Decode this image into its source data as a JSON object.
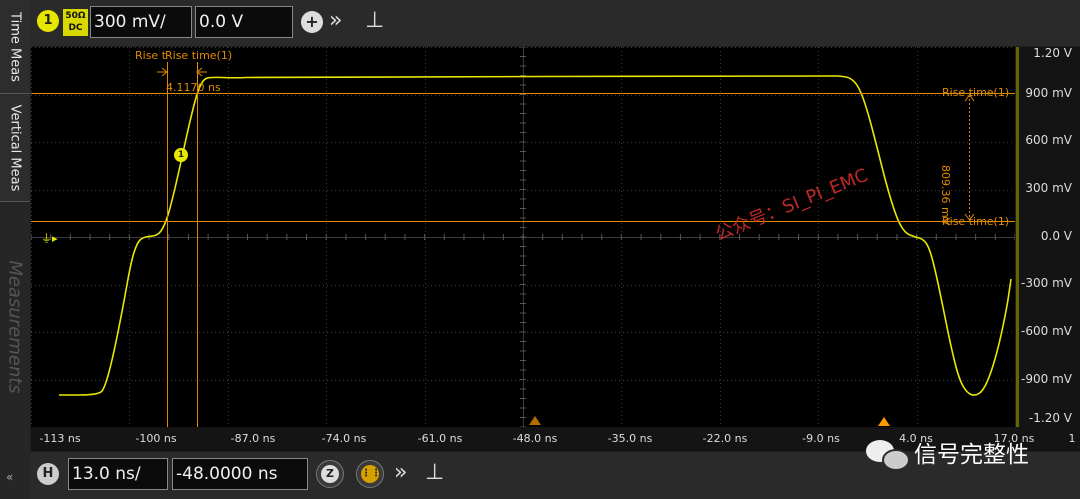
{
  "channel": {
    "number": "1",
    "impedance": "50Ω",
    "coupling": "DC",
    "scale": "300 mV/",
    "offset": "0.0 V"
  },
  "left_tabs": [
    "Time Meas",
    "Vertical Meas",
    "Measurements"
  ],
  "y_axis_labels": [
    "1.20 V",
    "900 mV",
    "600 mV",
    "300 mV",
    "0.0 V",
    "-300 mV",
    "-600 mV",
    "-900 mV",
    "-1.20 V"
  ],
  "x_axis_labels": [
    "-113 ns",
    "-100 ns",
    "-87.0 ns",
    "-74.0 ns",
    "-61.0 ns",
    "-48.0 ns",
    "-35.0 ns",
    "-22.0 ns",
    "-9.0 ns",
    "4.0 ns",
    "17.0 ns"
  ],
  "x_axis_edge": "1",
  "cursor_labels": {
    "rise_left": "Rise t",
    "rise_main": "Rise time(1)",
    "delta_value": "4.1170 ns",
    "upper_marker": "Rise time(1)",
    "lower_marker": "Rise time(1)",
    "vertical_delta": "809.36 mV",
    "waveform_marker": "1"
  },
  "watermark": "公众号：SI_PI_EMC",
  "timebase": {
    "label": "H",
    "scale": "13.0 ns/",
    "position": "-48.0000 ns",
    "zoom_icon": "Z"
  },
  "brand_text": "信号完整性",
  "colors": {
    "trace": "#e8e800",
    "cursor": "#e08a00",
    "grid": "#3a3a3a"
  }
}
